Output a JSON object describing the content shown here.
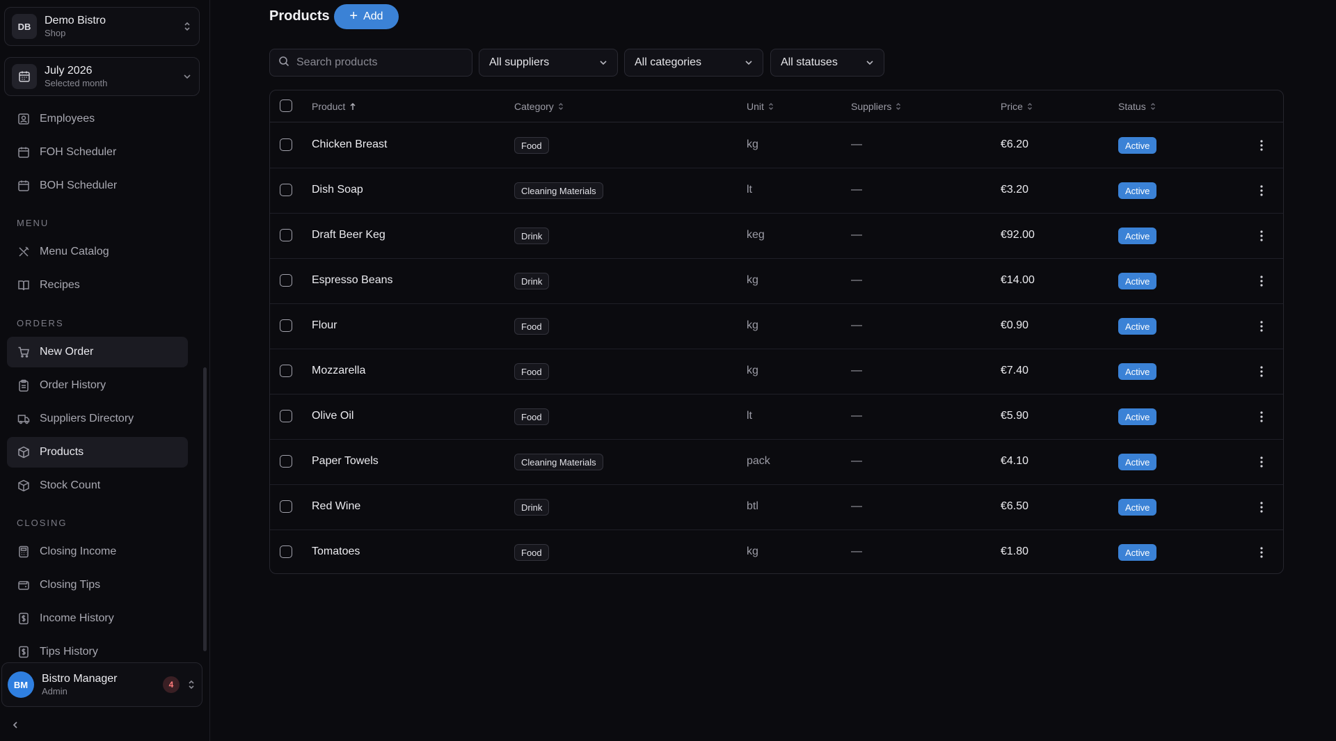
{
  "sidebar": {
    "shop": {
      "initials": "DB",
      "name": "Demo Bistro",
      "subtitle": "Shop"
    },
    "month": {
      "title": "July 2026",
      "subtitle": "Selected month"
    },
    "items": [
      {
        "label": "Employees",
        "icon": "user-badge-icon"
      },
      {
        "label": "FOH Scheduler",
        "icon": "calendar-icon"
      },
      {
        "label": "BOH Scheduler",
        "icon": "calendar-icon"
      },
      {
        "label": "Menu Catalog",
        "icon": "utensils-icon"
      },
      {
        "label": "Recipes",
        "icon": "book-icon"
      },
      {
        "label": "New Order",
        "icon": "cart-icon"
      },
      {
        "label": "Order History",
        "icon": "clipboard-icon"
      },
      {
        "label": "Suppliers Directory",
        "icon": "truck-icon"
      },
      {
        "label": "Products",
        "icon": "box-icon"
      },
      {
        "label": "Stock Count",
        "icon": "box-icon"
      },
      {
        "label": "Closing Income",
        "icon": "calculator-icon"
      },
      {
        "label": "Closing Tips",
        "icon": "wallet-icon"
      },
      {
        "label": "Income History",
        "icon": "receipt-dollar-icon"
      },
      {
        "label": "Tips History",
        "icon": "receipt-dollar-icon"
      }
    ],
    "sections": {
      "menu": "MENU",
      "orders": "ORDERS",
      "closing": "CLOSING"
    },
    "user": {
      "initials": "BM",
      "name": "Bistro Manager",
      "role": "Admin",
      "notifications": "4"
    }
  },
  "header": {
    "title": "Products",
    "add_label": "Add"
  },
  "filters": {
    "search_placeholder": "Search products",
    "suppliers": "All suppliers",
    "categories": "All categories",
    "statuses": "All statuses"
  },
  "table": {
    "columns": {
      "product": "Product",
      "category": "Category",
      "unit": "Unit",
      "suppliers": "Suppliers",
      "price": "Price",
      "status": "Status"
    },
    "rows": [
      {
        "name": "Chicken Breast",
        "category": "Food",
        "unit": "kg",
        "suppliers": "—",
        "price": "€6.20",
        "status": "Active"
      },
      {
        "name": "Dish Soap",
        "category": "Cleaning Materials",
        "unit": "lt",
        "suppliers": "—",
        "price": "€3.20",
        "status": "Active"
      },
      {
        "name": "Draft Beer Keg",
        "category": "Drink",
        "unit": "keg",
        "suppliers": "—",
        "price": "€92.00",
        "status": "Active"
      },
      {
        "name": "Espresso Beans",
        "category": "Drink",
        "unit": "kg",
        "suppliers": "—",
        "price": "€14.00",
        "status": "Active"
      },
      {
        "name": "Flour",
        "category": "Food",
        "unit": "kg",
        "suppliers": "—",
        "price": "€0.90",
        "status": "Active"
      },
      {
        "name": "Mozzarella",
        "category": "Food",
        "unit": "kg",
        "suppliers": "—",
        "price": "€7.40",
        "status": "Active"
      },
      {
        "name": "Olive Oil",
        "category": "Food",
        "unit": "lt",
        "suppliers": "—",
        "price": "€5.90",
        "status": "Active"
      },
      {
        "name": "Paper Towels",
        "category": "Cleaning Materials",
        "unit": "pack",
        "suppliers": "—",
        "price": "€4.10",
        "status": "Active"
      },
      {
        "name": "Red Wine",
        "category": "Drink",
        "unit": "btl",
        "suppliers": "—",
        "price": "€6.50",
        "status": "Active"
      },
      {
        "name": "Tomatoes",
        "category": "Food",
        "unit": "kg",
        "suppliers": "—",
        "price": "€1.80",
        "status": "Active"
      }
    ]
  },
  "colors": {
    "accent": "#3b82d6",
    "background": "#0b0b0f",
    "avatar": "#2f7fe0"
  }
}
